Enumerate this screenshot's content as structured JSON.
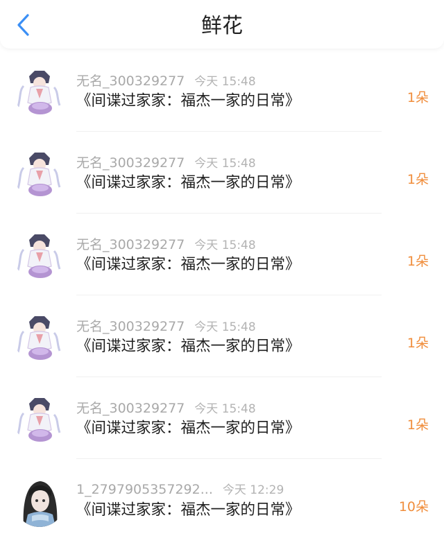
{
  "header": {
    "title": "鲜花"
  },
  "list": [
    {
      "username": "无名_300329277",
      "time": "今天 15:48",
      "book": "《间谍过家家：福杰一家的日常》",
      "count": "1朵",
      "avatar": "anime-character-avatar"
    },
    {
      "username": "无名_300329277",
      "time": "今天 15:48",
      "book": "《间谍过家家：福杰一家的日常》",
      "count": "1朵",
      "avatar": "anime-character-avatar"
    },
    {
      "username": "无名_300329277",
      "time": "今天 15:48",
      "book": "《间谍过家家：福杰一家的日常》",
      "count": "1朵",
      "avatar": "anime-character-avatar"
    },
    {
      "username": "无名_300329277",
      "time": "今天 15:48",
      "book": "《间谍过家家：福杰一家的日常》",
      "count": "1朵",
      "avatar": "anime-character-avatar"
    },
    {
      "username": "无名_300329277",
      "time": "今天 15:48",
      "book": "《间谍过家家：福杰一家的日常》",
      "count": "1朵",
      "avatar": "anime-character-avatar"
    },
    {
      "username": "1_2797905357292...",
      "time": "今天 12:29",
      "book": "《间谍过家家：福杰一家的日常》",
      "count": "10朵",
      "avatar": "dark-hair-girl-avatar"
    }
  ],
  "colors": {
    "accent_blue": "#3b8ff5",
    "count_orange": "#f08d3b",
    "meta_gray": "#a9a9a9",
    "title_text": "#1f1f1f"
  }
}
